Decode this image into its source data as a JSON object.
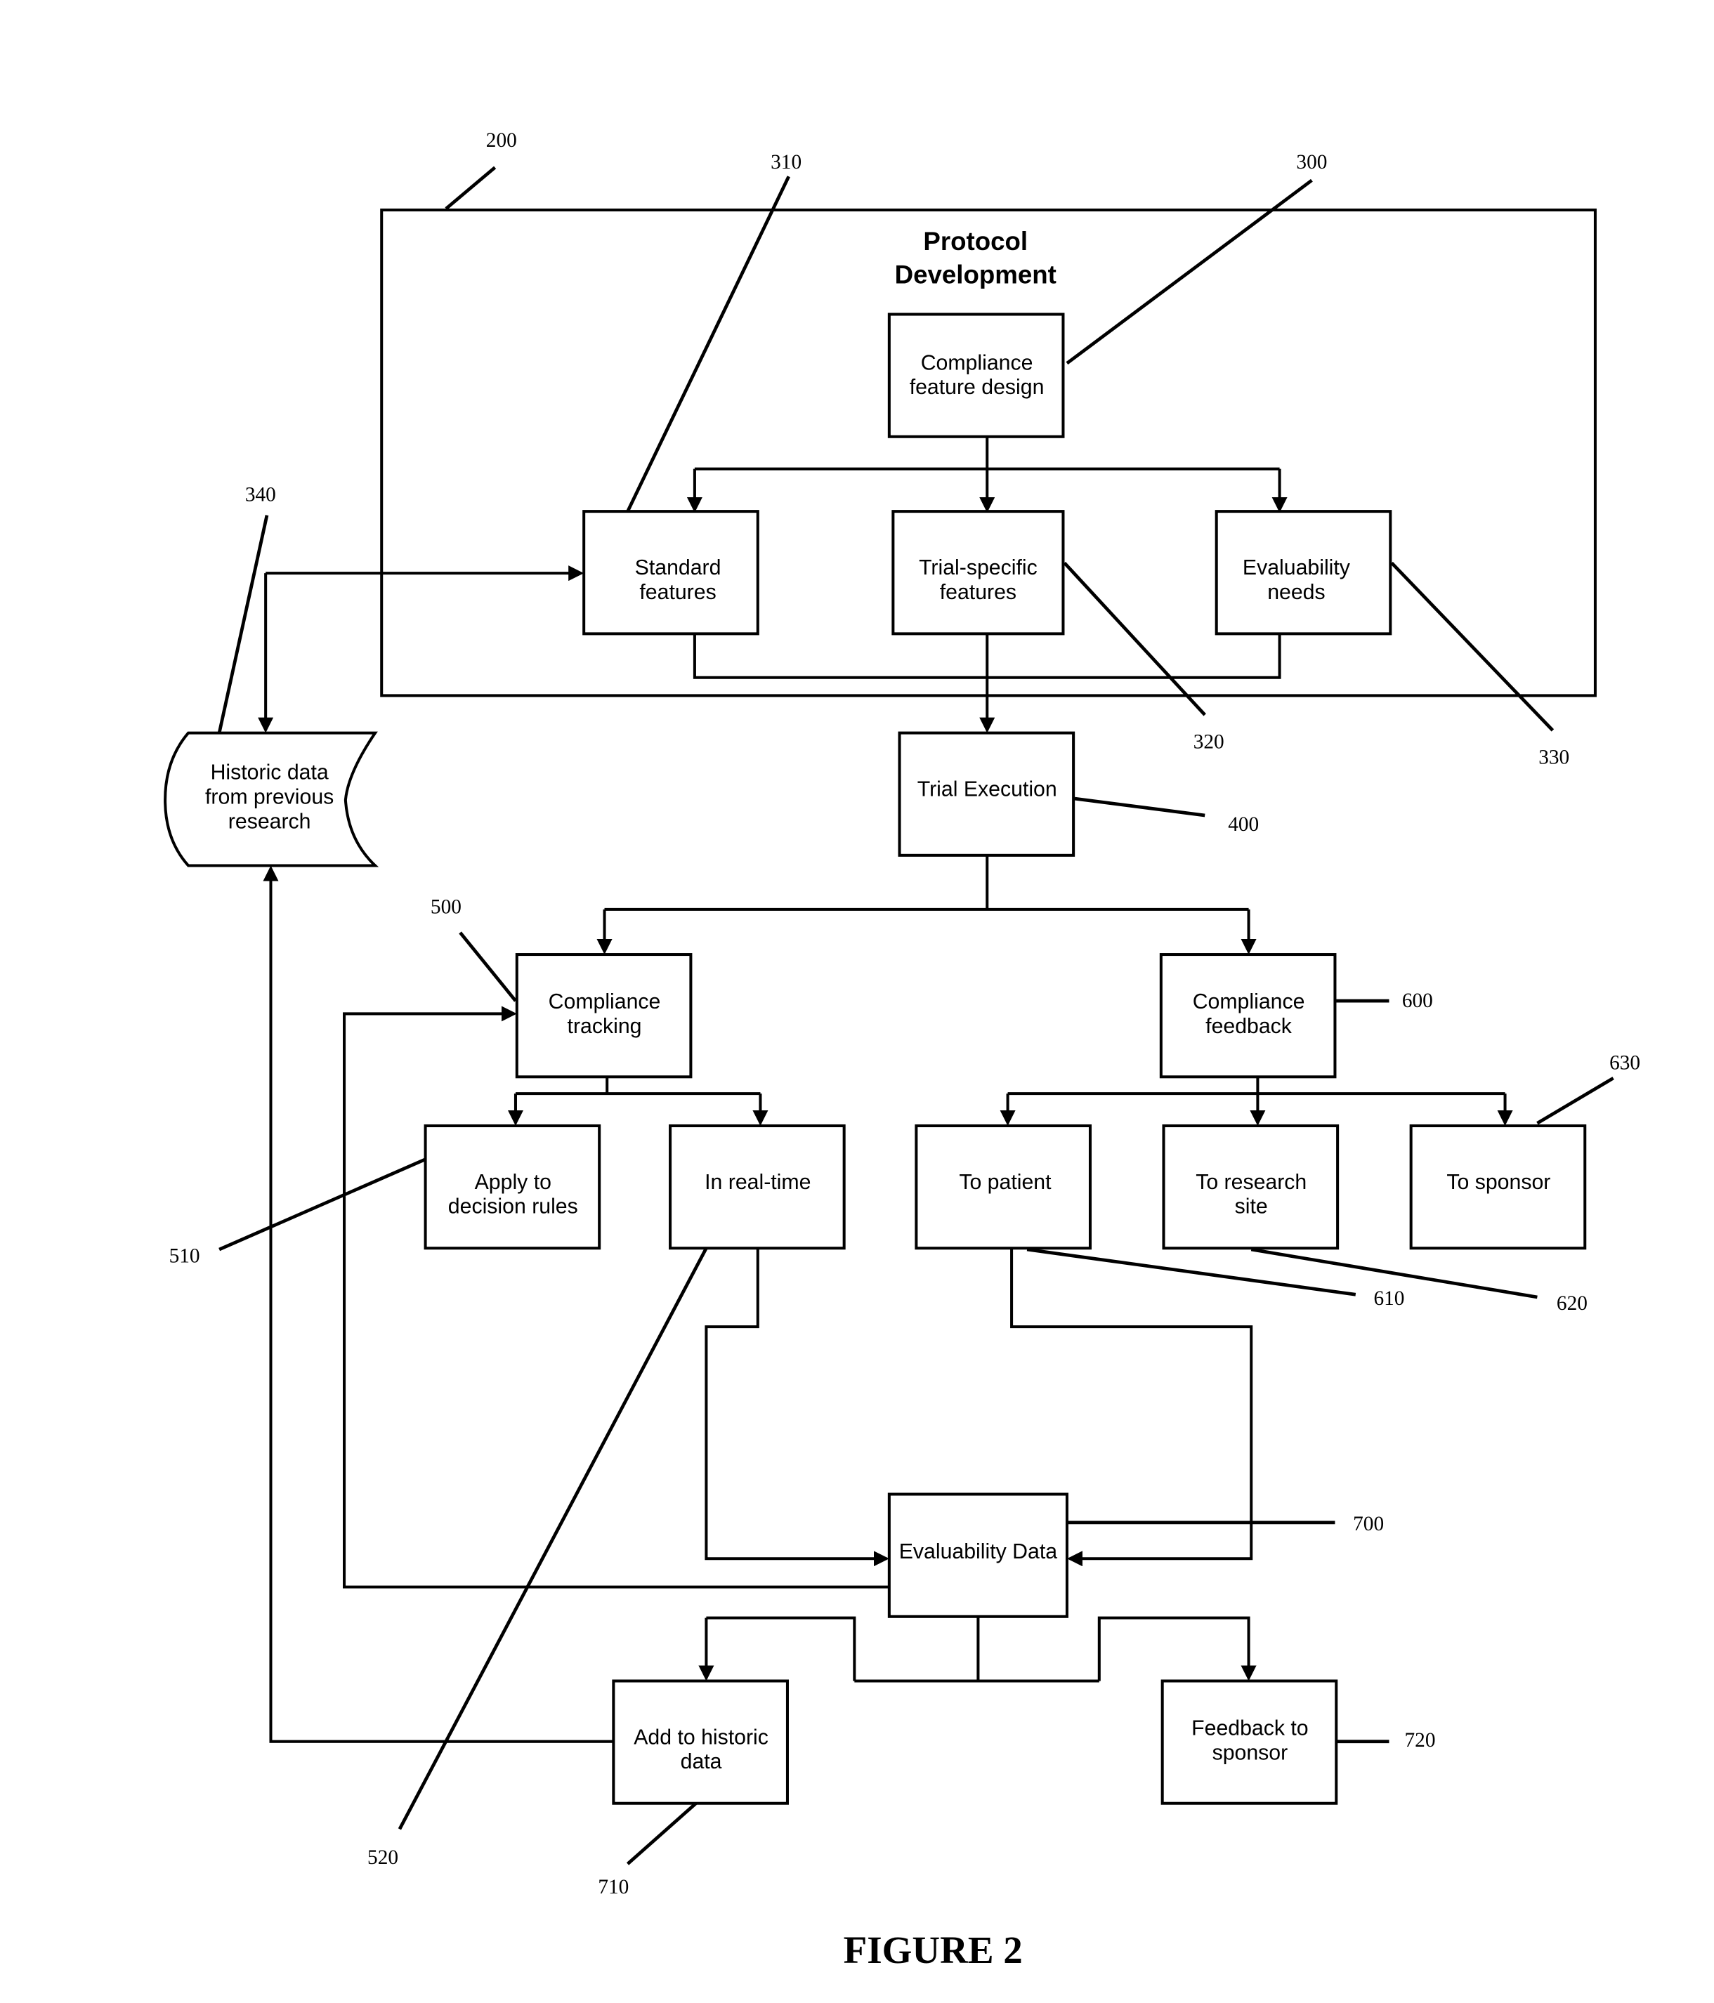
{
  "figure_caption": "FIGURE 2",
  "protocol_development": {
    "title_line1": "Protocol",
    "title_line2": "Development",
    "ref": "200"
  },
  "nodes": {
    "compliance_feature_design": {
      "line1": "Compliance",
      "line2": "feature design",
      "ref": "300"
    },
    "standard_features": {
      "line1": "Standard",
      "line2": "features",
      "ref": "310"
    },
    "trial_specific_features": {
      "line1": "Trial-specific",
      "line2": "features",
      "ref": "320"
    },
    "evaluability_needs": {
      "line1": "Evaluability",
      "line2": "needs",
      "ref": "330"
    },
    "historic_data": {
      "line1": "Historic data",
      "line2": "from previous",
      "line3": "research",
      "ref": "340"
    },
    "trial_execution": {
      "line1": "Trial Execution",
      "ref": "400"
    },
    "compliance_tracking": {
      "line1": "Compliance",
      "line2": "tracking",
      "ref": "500"
    },
    "apply_to_decision_rules": {
      "line1": "Apply to",
      "line2": "decision rules",
      "ref": "510"
    },
    "in_real_time": {
      "line1": "In real-time",
      "ref": "520"
    },
    "compliance_feedback": {
      "line1": "Compliance",
      "line2": "feedback",
      "ref": "600"
    },
    "to_patient": {
      "line1": "To patient",
      "ref": "610"
    },
    "to_research_site": {
      "line1": "To research",
      "line2": "site",
      "ref": "620"
    },
    "to_sponsor": {
      "line1": "To sponsor",
      "ref": "630"
    },
    "evaluability_data": {
      "line1": "Evaluability Data",
      "ref": "700"
    },
    "add_to_historic_data": {
      "line1": "Add to historic",
      "line2": "data",
      "ref": "710"
    },
    "feedback_to_sponsor": {
      "line1": "Feedback to",
      "line2": "sponsor",
      "ref": "720"
    }
  }
}
